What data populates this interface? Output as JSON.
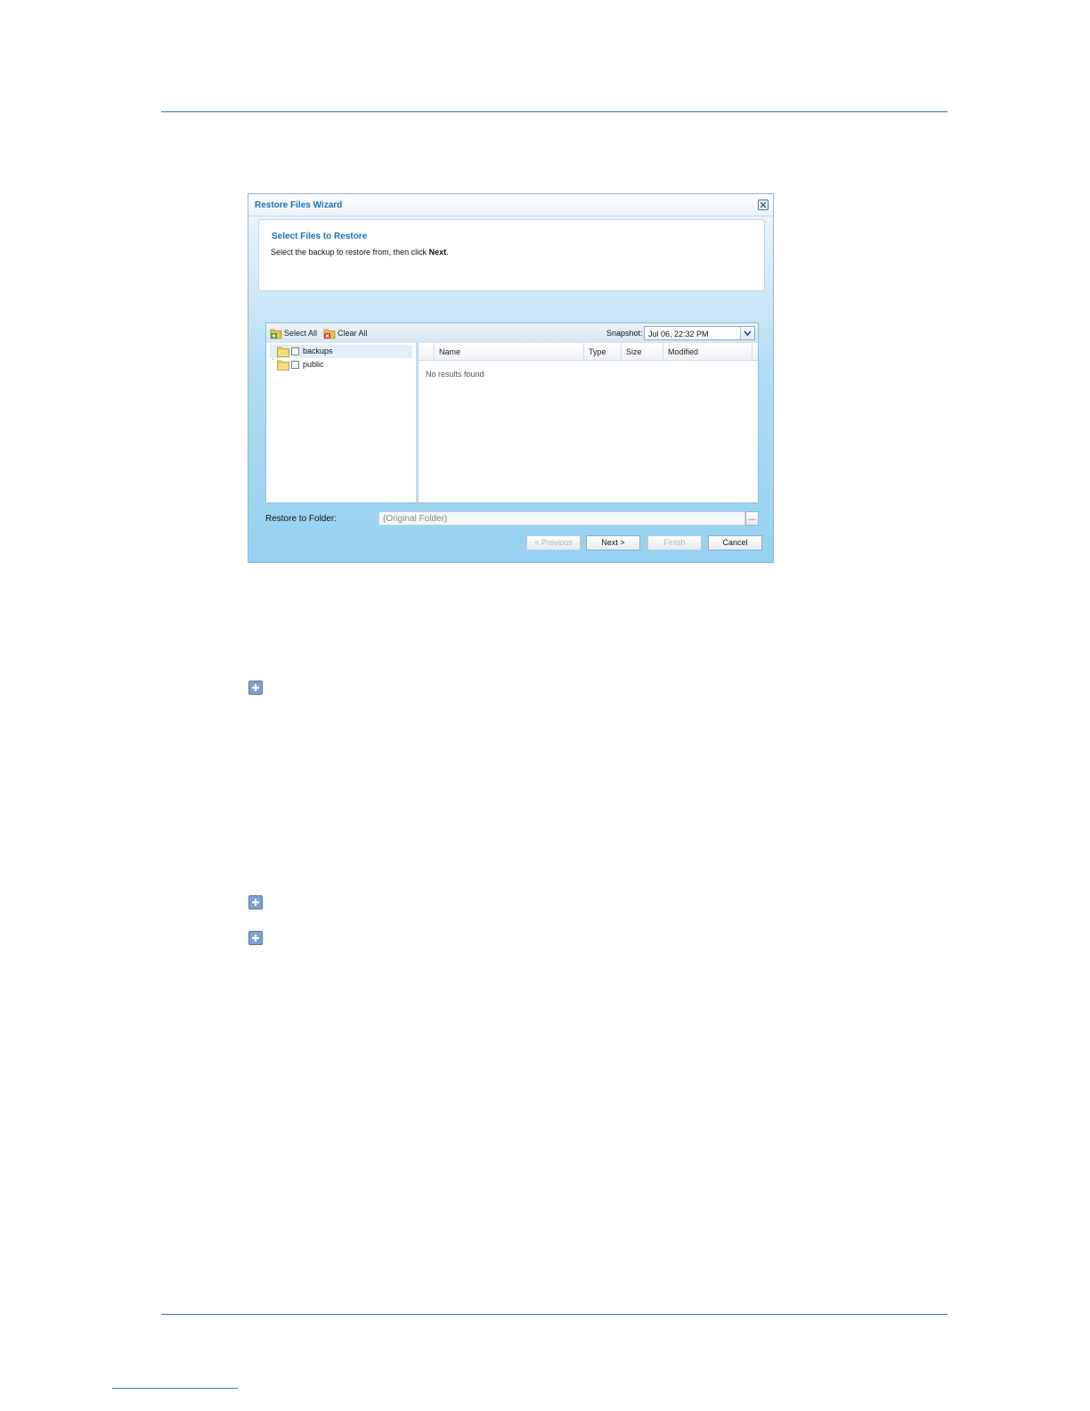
{
  "window": {
    "title": "Restore Files Wizard"
  },
  "header": {
    "title": "Select Files to Restore",
    "instruction_prefix": "Select the backup to restore from, then click ",
    "instruction_bold": "Next",
    "instruction_suffix": "."
  },
  "toolbar": {
    "select_all": "Select All",
    "clear_all": "Clear All",
    "snapshot_label": "Snapshot:",
    "snapshot_value": "Jul 06, 22:32 PM"
  },
  "tree": {
    "items": [
      {
        "label": "backups",
        "selected": true
      },
      {
        "label": "public",
        "selected": false
      }
    ]
  },
  "grid": {
    "columns": [
      "Name",
      "Type",
      "Size",
      "Modified"
    ],
    "empty_text": "No results found"
  },
  "restore": {
    "label": "Restore to Folder:",
    "placeholder": "(Original Folder)",
    "browse": "..."
  },
  "buttons": {
    "previous": "< Previous",
    "next": "Next >",
    "finish": "Finish",
    "cancel": "Cancel"
  },
  "colors": {
    "accent": "#1b6fb5",
    "rule": "#2f73b8"
  },
  "icons": [
    "close-icon",
    "select-all-icon",
    "clear-all-icon",
    "chevron-down-icon",
    "folder-icon",
    "expand-plus-icon"
  ]
}
